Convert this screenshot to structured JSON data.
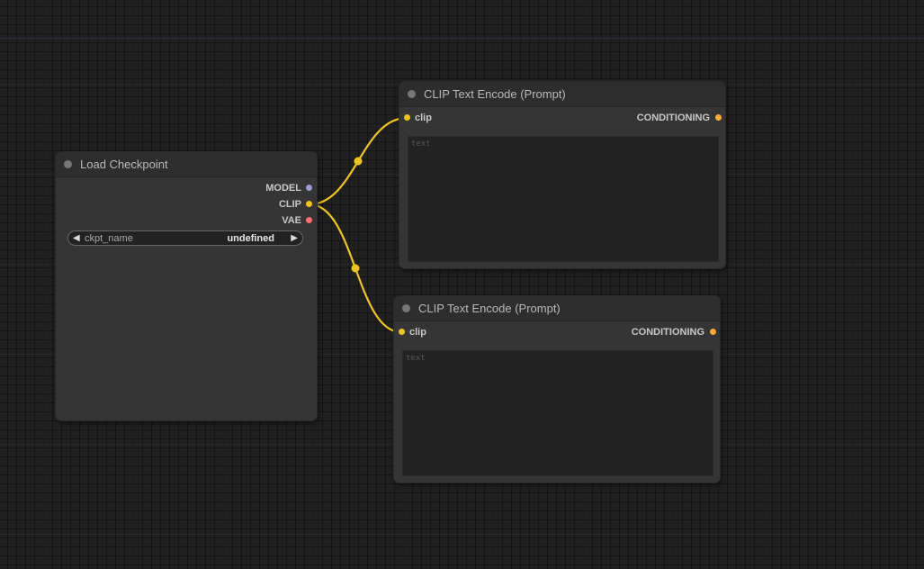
{
  "canvas": {
    "background": "#202020",
    "link_color": "#f0c419"
  },
  "nodes": {
    "load_checkpoint": {
      "title": "Load Checkpoint",
      "outputs": [
        {
          "label": "MODEL",
          "color": "#9c9cd6"
        },
        {
          "label": "CLIP",
          "color": "#f0c419"
        },
        {
          "label": "VAE",
          "color": "#ff6e6e"
        }
      ],
      "widget": {
        "name": "ckpt_name",
        "value": "undefined",
        "left_arrow": "◀",
        "right_arrow": "▶"
      }
    },
    "clip_encode_1": {
      "title": "CLIP Text Encode (Prompt)",
      "input": {
        "label": "clip",
        "color": "#f0c419"
      },
      "output": {
        "label": "CONDITIONING",
        "color": "#ffa931"
      },
      "text_placeholder": "text",
      "text_value": ""
    },
    "clip_encode_2": {
      "title": "CLIP Text Encode (Prompt)",
      "input": {
        "label": "clip",
        "color": "#f0c419"
      },
      "output": {
        "label": "CONDITIONING",
        "color": "#ffa931"
      },
      "text_placeholder": "text",
      "text_value": ""
    }
  }
}
